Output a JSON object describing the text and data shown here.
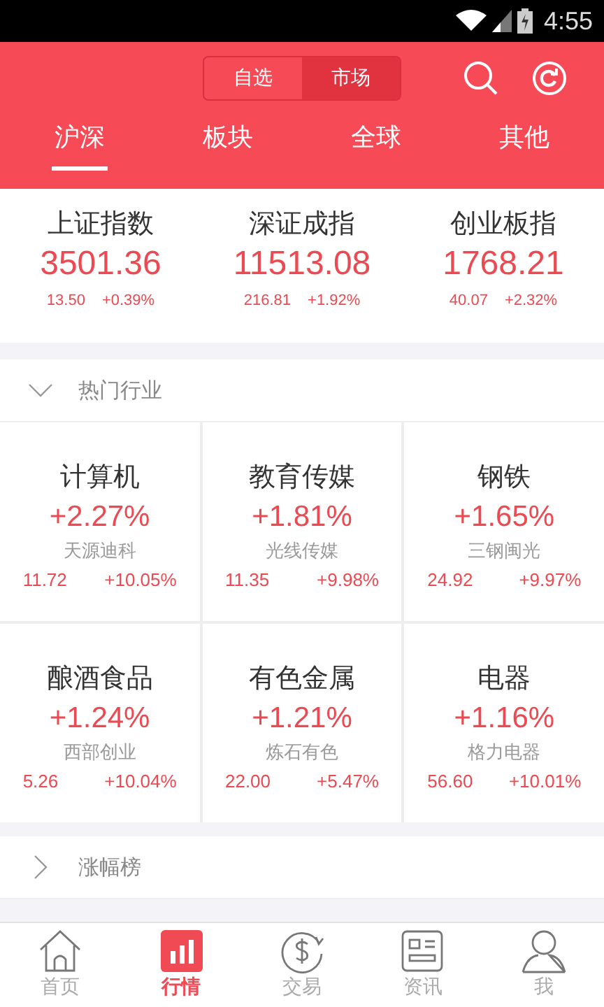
{
  "status_bar": {
    "time": "4:55"
  },
  "segment": [
    {
      "label": "自选",
      "selected": false
    },
    {
      "label": "市场",
      "selected": true
    }
  ],
  "tabs": [
    {
      "label": "沪深",
      "selected": true
    },
    {
      "label": "板块",
      "selected": false
    },
    {
      "label": "全球",
      "selected": false
    },
    {
      "label": "其他",
      "selected": false
    }
  ],
  "indices": [
    {
      "name": "上证指数",
      "value": "3501.36",
      "change": "13.50",
      "percent": "+0.39%"
    },
    {
      "name": "深证成指",
      "value": "11513.08",
      "change": "216.81",
      "percent": "+1.92%"
    },
    {
      "name": "创业板指",
      "value": "1768.21",
      "change": "40.07",
      "percent": "+2.32%"
    }
  ],
  "hot_section": {
    "title": "热门行业",
    "expanded": true
  },
  "industries": [
    {
      "name": "计算机",
      "percent": "+2.27%",
      "leader": "天源迪科",
      "price": "11.72",
      "leader_percent": "+10.05%"
    },
    {
      "name": "教育传媒",
      "percent": "+1.81%",
      "leader": "光线传媒",
      "price": "11.35",
      "leader_percent": "+9.98%"
    },
    {
      "name": "钢铁",
      "percent": "+1.65%",
      "leader": "三钢闽光",
      "price": "24.92",
      "leader_percent": "+9.97%"
    },
    {
      "name": "酿酒食品",
      "percent": "+1.24%",
      "leader": "西部创业",
      "price": "5.26",
      "leader_percent": "+10.04%"
    },
    {
      "name": "有色金属",
      "percent": "+1.21%",
      "leader": "炼石有色",
      "price": "22.00",
      "leader_percent": "+5.47%"
    },
    {
      "name": "电器",
      "percent": "+1.16%",
      "leader": "格力电器",
      "price": "56.60",
      "leader_percent": "+10.01%"
    }
  ],
  "gainers_section": {
    "title": "涨幅榜",
    "expanded": false
  },
  "bottom_nav": [
    {
      "label": "首页",
      "kind": "home",
      "selected": false
    },
    {
      "label": "行情",
      "kind": "market",
      "selected": true
    },
    {
      "label": "交易",
      "kind": "trade",
      "selected": false
    },
    {
      "label": "资讯",
      "kind": "news",
      "selected": false
    },
    {
      "label": "我",
      "kind": "me",
      "selected": false
    }
  ]
}
